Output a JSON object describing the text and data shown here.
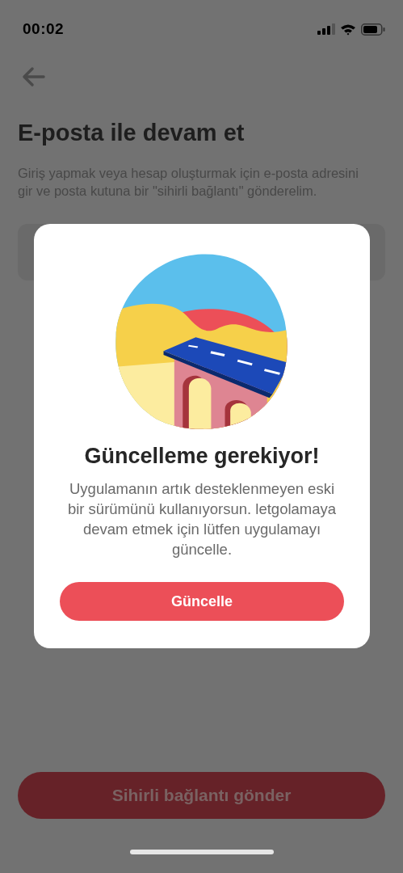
{
  "status_bar": {
    "time": "00:02"
  },
  "page": {
    "title": "E-posta ile devam et",
    "description": "Giriş yapmak veya hesap oluşturmak için e-posta adresini gir ve posta kutuna bir \"sihirli bağlantı\" gönderelim.",
    "submit_button": {
      "label": "Sihirli bağlantı gönder"
    }
  },
  "dialog": {
    "title": "Güncelleme gerekiyor!",
    "message": "Uygulamanın artık desteklenmeyen eski bir sürümünü kullanıyorsun. letgolamaya devam etmek için lütfen uygulamayı güncelle.",
    "button": {
      "label": "Güncelle"
    }
  }
}
